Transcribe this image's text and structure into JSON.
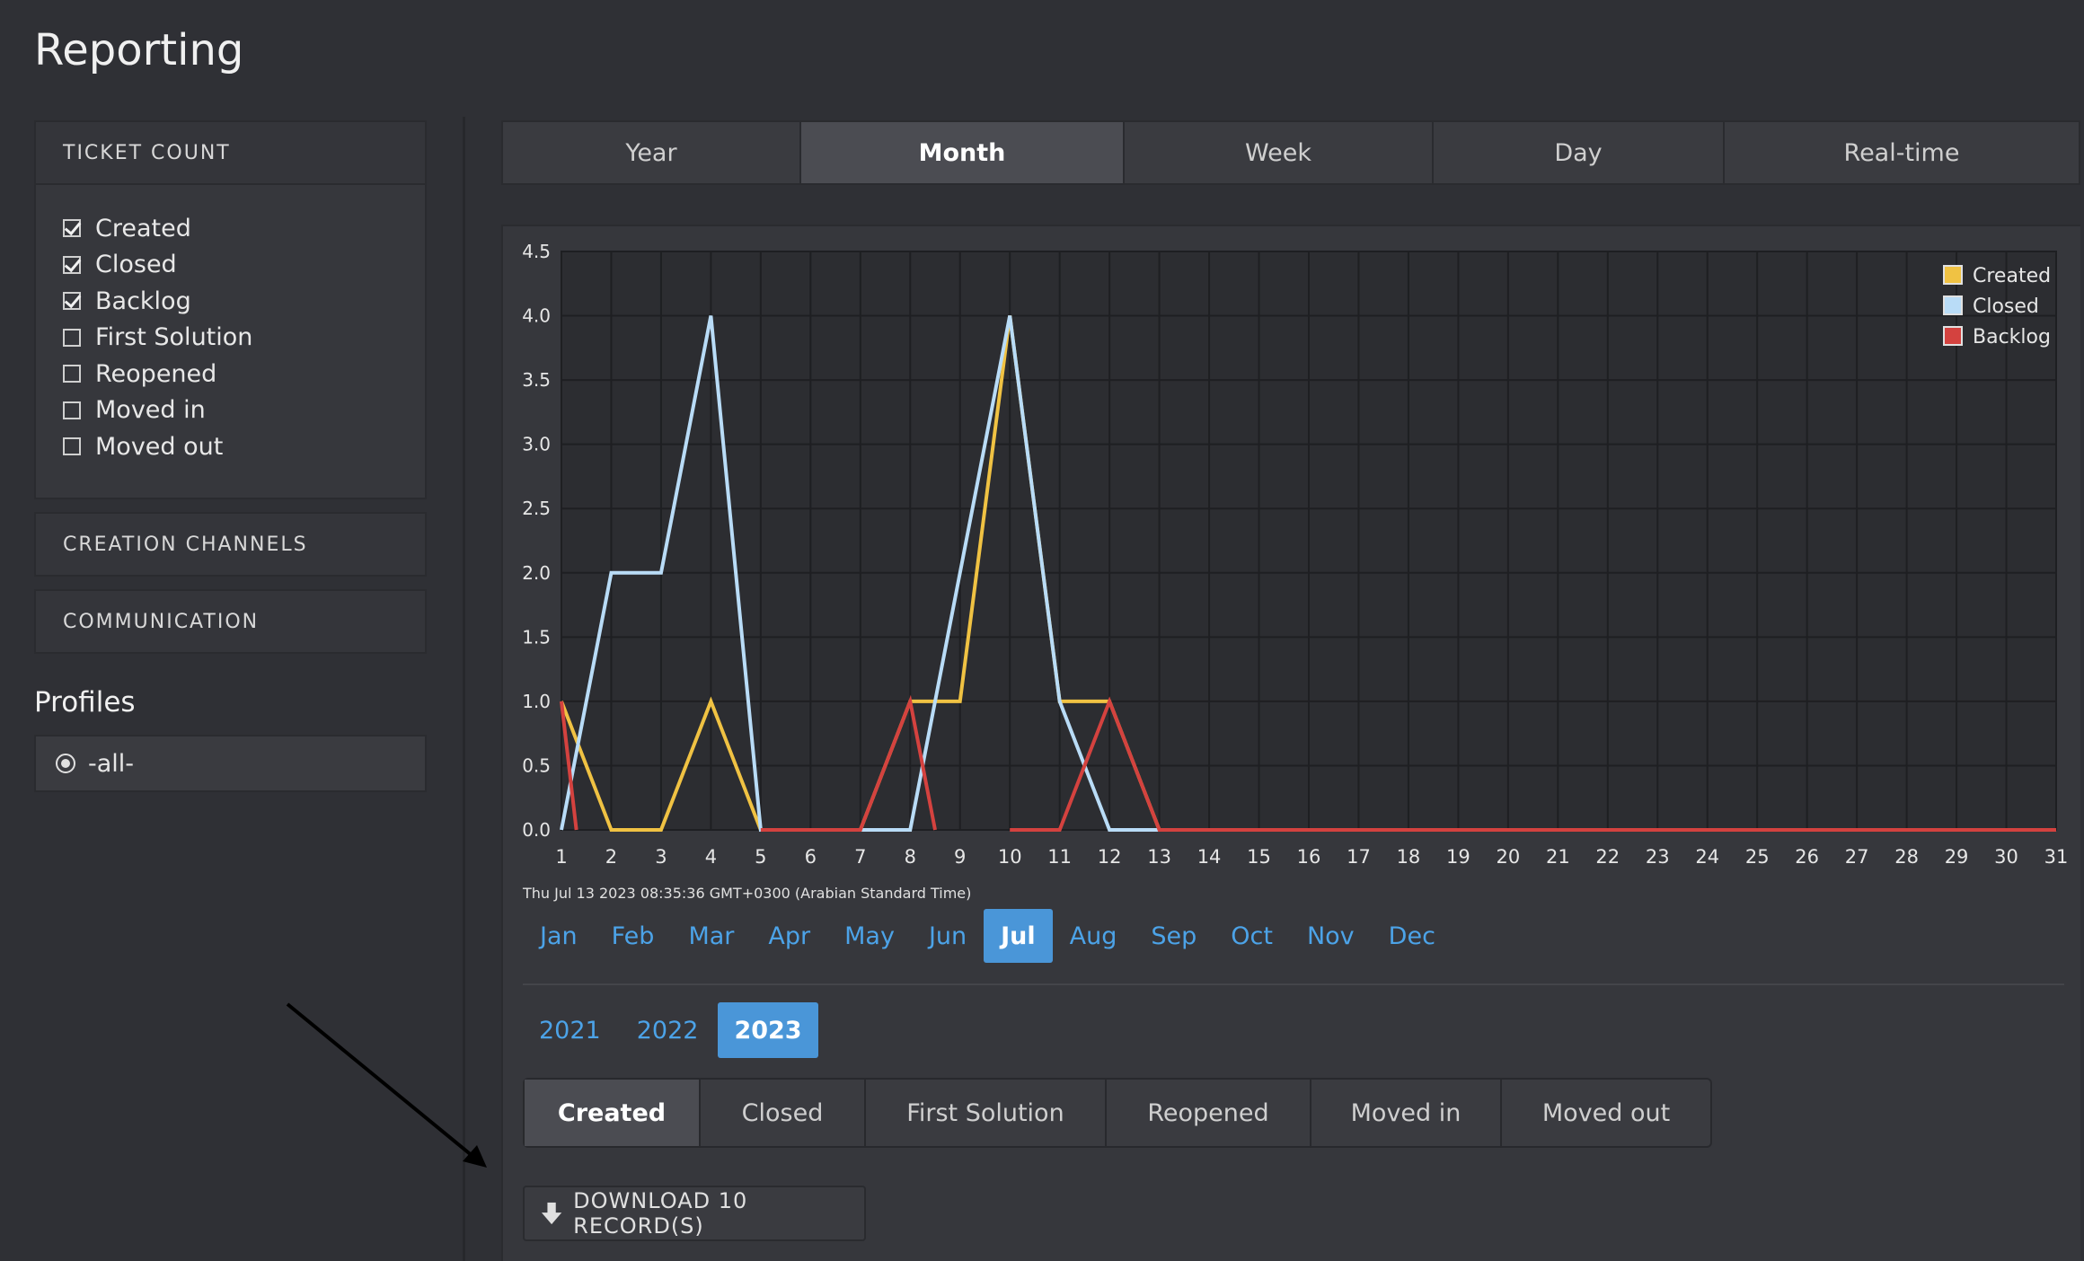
{
  "page_title": "Reporting",
  "sidebar": {
    "ticket_count": {
      "title": "TICKET COUNT",
      "items": [
        {
          "label": "Created",
          "checked": true
        },
        {
          "label": "Closed",
          "checked": true
        },
        {
          "label": "Backlog",
          "checked": true
        },
        {
          "label": "First Solution",
          "checked": false
        },
        {
          "label": "Reopened",
          "checked": false
        },
        {
          "label": "Moved in",
          "checked": false
        },
        {
          "label": "Moved out",
          "checked": false
        }
      ]
    },
    "creation_channels": "CREATION CHANNELS",
    "communication": "COMMUNICATION",
    "profiles_title": "Profiles",
    "profile_selected": "-all-"
  },
  "period_tabs": [
    "Year",
    "Month",
    "Week",
    "Day",
    "Real-time"
  ],
  "period_active": "Month",
  "timestamp": "Thu Jul 13 2023 08:35:36 GMT+0300 (Arabian Standard Time)",
  "months": [
    "Jan",
    "Feb",
    "Mar",
    "Apr",
    "May",
    "Jun",
    "Jul",
    "Aug",
    "Sep",
    "Oct",
    "Nov",
    "Dec"
  ],
  "month_active": "Jul",
  "years": [
    "2021",
    "2022",
    "2023"
  ],
  "year_active": "2023",
  "metric_tabs": [
    "Created",
    "Closed",
    "First Solution",
    "Reopened",
    "Moved in",
    "Moved out"
  ],
  "metric_active": "Created",
  "download_label": "DOWNLOAD 10 RECORD(S)",
  "colors": {
    "created": "#f0c243",
    "closed": "#b9dcf7",
    "backlog": "#d4423f",
    "accent": "#4a96d8"
  },
  "chart_data": {
    "type": "line",
    "x": [
      1,
      2,
      3,
      4,
      5,
      6,
      7,
      8,
      9,
      10,
      11,
      12,
      13,
      14,
      15,
      16,
      17,
      18,
      19,
      20,
      21,
      22,
      23,
      24,
      25,
      26,
      27,
      28,
      29,
      30,
      31
    ],
    "ylim": [
      0,
      4.5
    ],
    "yticks": [
      "0.0",
      "0.5",
      "1.0",
      "1.5",
      "2.0",
      "2.5",
      "3.0",
      "3.5",
      "4.0",
      "4.5"
    ],
    "legend_position": "top-right",
    "grid": true,
    "series": [
      {
        "name": "Created",
        "color": "#f0c243",
        "values": [
          1,
          0,
          0,
          1,
          0,
          0,
          0,
          1,
          1,
          4,
          1,
          1,
          0,
          0,
          0,
          0,
          0,
          0,
          0,
          0,
          0,
          0,
          0,
          0,
          0,
          0,
          0,
          0,
          0,
          0,
          0
        ]
      },
      {
        "name": "Closed",
        "color": "#b9dcf7",
        "values": [
          0,
          2,
          2,
          4,
          0,
          0,
          0,
          0,
          2,
          4,
          1,
          0,
          0,
          0,
          0,
          0,
          0,
          0,
          0,
          0,
          0,
          0,
          0,
          0,
          0,
          0,
          0,
          0,
          0,
          0,
          0
        ]
      },
      {
        "name": "Backlog",
        "color": "#d4423f",
        "segments": [
          [
            [
              1,
              1
            ],
            [
              1.3,
              0
            ]
          ],
          [
            [
              5,
              0
            ],
            [
              6,
              0
            ],
            [
              7,
              0
            ],
            [
              8,
              1
            ],
            [
              8.5,
              0
            ]
          ],
          [
            [
              10,
              0
            ],
            [
              11,
              0
            ],
            [
              12,
              1
            ],
            [
              13,
              0
            ],
            [
              14,
              0
            ],
            [
              15,
              0
            ],
            [
              16,
              0
            ],
            [
              17,
              0
            ],
            [
              18,
              0
            ],
            [
              19,
              0
            ],
            [
              20,
              0
            ],
            [
              21,
              0
            ],
            [
              22,
              0
            ],
            [
              23,
              0
            ],
            [
              24,
              0
            ],
            [
              25,
              0
            ],
            [
              26,
              0
            ],
            [
              27,
              0
            ],
            [
              28,
              0
            ],
            [
              29,
              0
            ],
            [
              30,
              0
            ],
            [
              31,
              0
            ]
          ]
        ]
      }
    ]
  }
}
